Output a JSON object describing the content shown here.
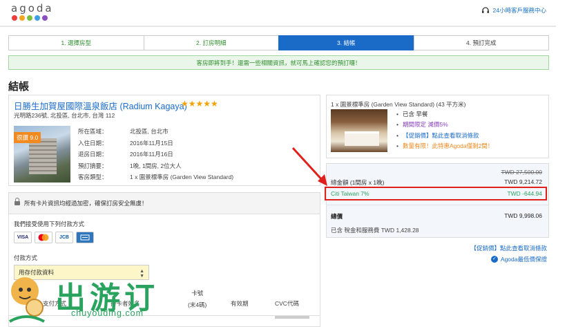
{
  "header": {
    "logo": "agoda",
    "logo_dot_colors": [
      "#f03c3c",
      "#f5a623",
      "#7ac142",
      "#3ea0e2",
      "#8a4fbf"
    ],
    "support": "24小時客戶服務中心"
  },
  "steps": [
    "1. 選擇房型",
    "2. 訂房明細",
    "3. 結帳",
    "4. 預訂完成"
  ],
  "active_step": 3,
  "notice": "客房即將到手！還需一些相關資訊，就可馬上確認您的預訂囉！",
  "page_title": "結帳",
  "hotel": {
    "name": "日勝生加賀屋國際溫泉飯店 (Radium Kagaya)",
    "stars": "★★★★★",
    "address": "光明路236號, 北投區, 台北市, 台灣 112",
    "review": "很讚 9.0",
    "details": [
      {
        "label": "所在區域：",
        "value": "北投區, 台北市"
      },
      {
        "label": "入住日期：",
        "value": "2016年11月15日"
      },
      {
        "label": "退房日期：",
        "value": "2016年11月16日"
      },
      {
        "label": "預訂摘要：",
        "value": "1晚, 1間房, 2位大人"
      },
      {
        "label": "客房類型：",
        "value": "1 x 園景標準房 (Garden View Standard)"
      }
    ]
  },
  "payment": {
    "secure_msg": "所有卡片資訊均經過加密，確保訂房安全無虞！",
    "accept_label": "我們接受使用下列付款方式",
    "cards": [
      "VISA",
      "MC",
      "JCB",
      "AMEX"
    ],
    "method_label": "付款方式",
    "method_value": "用存付款資料",
    "table_headers": {
      "col1": "支付方式",
      "col2": "持卡者姓名",
      "col3_line1": "卡號",
      "col3_line2": "(末4碼)",
      "col4": "有效期",
      "col5": "CVC代碼"
    }
  },
  "room": {
    "title": "1 x 園景標準房 (Garden View Standard) (43 平方米)",
    "features": [
      {
        "text": "已含 早餐",
        "color": "#333333"
      },
      {
        "text": "期間限定 減價5%",
        "color": "#8a3fbf"
      },
      {
        "text": "【促銷價】點此查看取消條款",
        "color": "#1a6bc8"
      },
      {
        "text": "數量有限！此特惠Agoda僅剩2間！",
        "color": "#f28a1f"
      }
    ]
  },
  "summary": {
    "original_price": "TWD 27,500.00",
    "total_label": "總金額 (1間房 x 1晚)",
    "total_value": "TWD 9,214.72",
    "promo_label": "Citi Taiwan 7%",
    "promo_value": "TWD -644.94",
    "grand_label": "總價",
    "grand_value": "TWD 9,998.06",
    "tax_note": "已含 稅金和服務費 TWD 1,428.28",
    "promo_color": "#2aa35f",
    "highlight_color": "#e0201c"
  },
  "links": {
    "cancel_terms": "【促銷價】點此查看取消條款",
    "best_price": "Agoda最低價保證"
  },
  "watermark": {
    "title": "出游订",
    "url": "chuyouding.com"
  }
}
